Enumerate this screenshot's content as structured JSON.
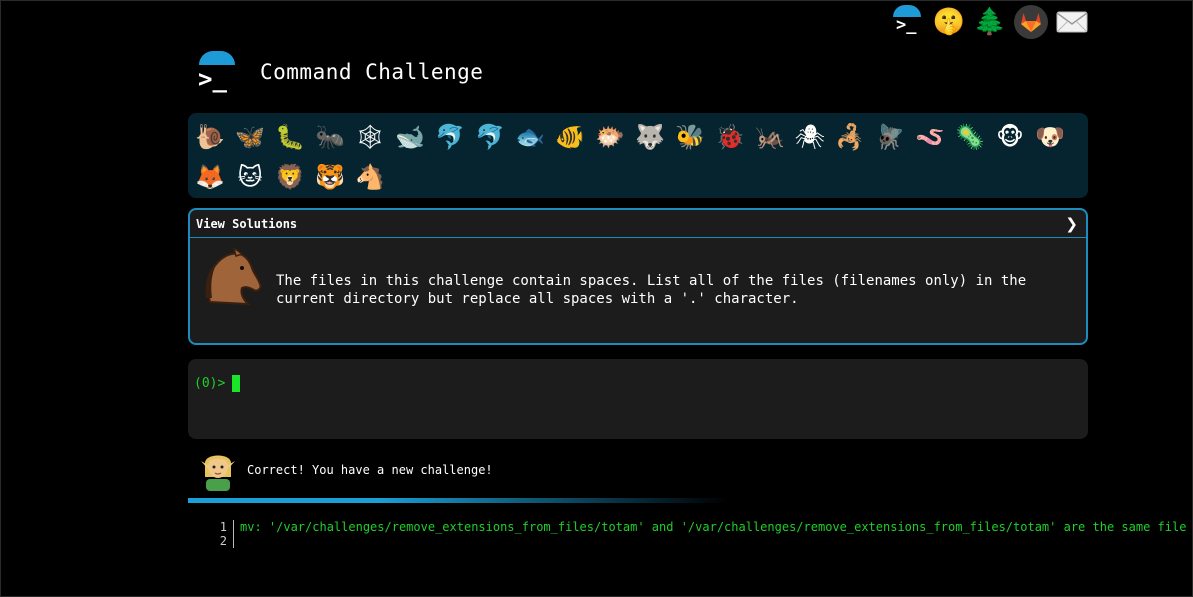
{
  "top_icons": [
    {
      "name": "terminal-icon",
      "glyph": ">_"
    },
    {
      "name": "shushing-face-icon",
      "glyph": "🤫"
    },
    {
      "name": "evergreen-tree-icon",
      "glyph": "🌲"
    },
    {
      "name": "gitlab-icon",
      "glyph": ""
    },
    {
      "name": "mail-icon",
      "glyph": ""
    }
  ],
  "header": {
    "title": "Command Challenge",
    "logo_prompt": ">_"
  },
  "levels": [
    {
      "name": "snail",
      "glyph": "🐌"
    },
    {
      "name": "butterfly",
      "glyph": "🦋"
    },
    {
      "name": "bug",
      "glyph": "🐛"
    },
    {
      "name": "ant",
      "glyph": "🐜"
    },
    {
      "name": "spider-web",
      "glyph": "🕸"
    },
    {
      "name": "whale",
      "glyph": "🐋"
    },
    {
      "name": "dolphin",
      "glyph": "🐬"
    },
    {
      "name": "dolphin-gray",
      "glyph": "🐬"
    },
    {
      "name": "fish",
      "glyph": "🐟"
    },
    {
      "name": "tropical-fish",
      "glyph": "🐠"
    },
    {
      "name": "blowfish",
      "glyph": "🐡"
    },
    {
      "name": "wolf",
      "glyph": "🐺"
    },
    {
      "name": "bee",
      "glyph": "🐝"
    },
    {
      "name": "lady-beetle",
      "glyph": "🐞"
    },
    {
      "name": "cricket",
      "glyph": "🦗"
    },
    {
      "name": "spider",
      "glyph": "🕷"
    },
    {
      "name": "scorpion",
      "glyph": "🦂"
    },
    {
      "name": "fly",
      "glyph": "🪰"
    },
    {
      "name": "worm",
      "glyph": "🪱"
    },
    {
      "name": "microbe",
      "glyph": "🦠"
    },
    {
      "name": "monkey",
      "glyph": "🐵"
    },
    {
      "name": "dog",
      "glyph": "🐶"
    },
    {
      "name": "fox",
      "glyph": "🦊"
    },
    {
      "name": "cat",
      "glyph": "🐱"
    },
    {
      "name": "lion",
      "glyph": "🦁"
    },
    {
      "name": "tiger",
      "glyph": "🐯"
    },
    {
      "name": "horse",
      "glyph": "🐴"
    }
  ],
  "challenge": {
    "view_solutions_label": "View Solutions",
    "chevron": "❯",
    "description": "The files in this challenge contain spaces. List all of the files (filenames only) in the current directory but replace all spaces with a '.' character."
  },
  "terminal": {
    "prompt": "(0)>"
  },
  "message": {
    "text": "Correct! You have a new challenge!"
  },
  "output": {
    "lines": [
      {
        "num": "1",
        "text": "mv: '/var/challenges/remove_extensions_from_files/totam' and '/var/challenges/remove_extensions_from_files/totam' are the same file"
      },
      {
        "num": "2",
        "text": ""
      }
    ]
  },
  "colors": {
    "accent": "#1e8bbf",
    "level_strip_bg": "#062430",
    "panel_bg": "#1c1c1c",
    "prompt_green": "#1fcf2a"
  }
}
